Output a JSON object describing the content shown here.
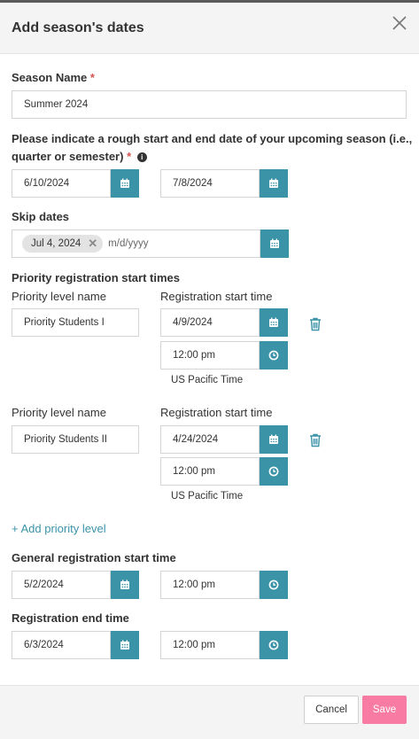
{
  "modal": {
    "title": "Add season's dates"
  },
  "season_name": {
    "label": "Season Name",
    "required": "*",
    "value": "Summer 2024"
  },
  "season_dates": {
    "label": "Please indicate a rough start and end date of your upcoming season (i.e.,",
    "label_line2": "quarter or semester)",
    "required": "*",
    "start": "6/10/2024",
    "end": "7/8/2024"
  },
  "skip_dates": {
    "label": "Skip dates",
    "chip": "Jul 4, 2024",
    "placeholder": "m/d/yyyy"
  },
  "priority": {
    "label": "Priority registration start times",
    "levels": [
      {
        "name_label": "Priority level name",
        "time_label": "Registration start time",
        "name": "Priority Students I",
        "date": "4/9/2024",
        "time": "12:00 pm",
        "tz": "US Pacific Time"
      },
      {
        "name_label": "Priority level name",
        "time_label": "Registration start time",
        "name": "Priority Students II",
        "date": "4/24/2024",
        "time": "12:00 pm",
        "tz": "US Pacific Time"
      }
    ],
    "add_label": "+ Add priority level"
  },
  "general": {
    "label": "General registration start time",
    "date": "5/2/2024",
    "time": "12:00 pm"
  },
  "end": {
    "label": "Registration end time",
    "date": "6/3/2024",
    "time": "12:00 pm"
  },
  "footer": {
    "cancel": "Cancel",
    "save": "Save"
  },
  "colors": {
    "accent": "#3b93a8",
    "save": "#f77ba3",
    "required": "#d9534f"
  },
  "icons": {
    "calendar": "calendar-icon",
    "clock": "clock-icon",
    "trash": "trash-icon",
    "close": "close-icon",
    "info": "info-icon"
  }
}
